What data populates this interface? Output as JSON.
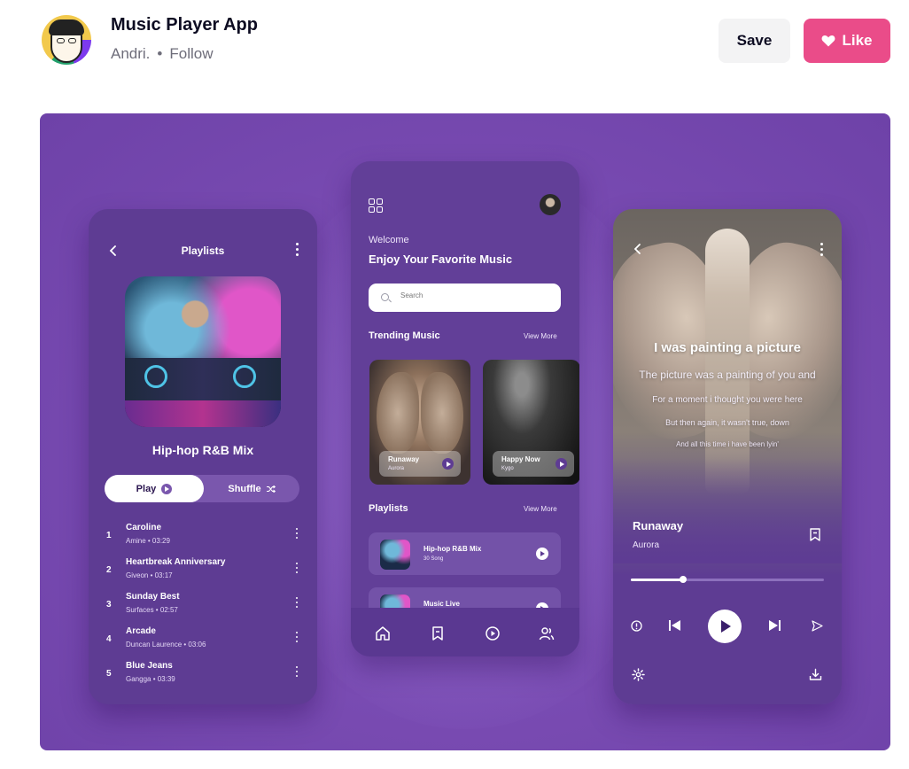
{
  "header": {
    "title": "Music Player App",
    "author": "Andri.",
    "separator": "•",
    "follow_label": "Follow",
    "save_label": "Save",
    "like_label": "Like",
    "like_color": "#ea4c89"
  },
  "shot": {
    "accent": "#7a4cb3",
    "playlist_screen": {
      "title": "Playlists",
      "mix_title": "Hip-hop R&B Mix",
      "play_label": "Play",
      "shuffle_label": "Shuffle",
      "tracks": [
        {
          "num": "1",
          "name": "Caroline",
          "meta": "Amine • 03:29"
        },
        {
          "num": "2",
          "name": "Heartbreak Anniversary",
          "meta": "Giveon • 03:17"
        },
        {
          "num": "3",
          "name": "Sunday Best",
          "meta": "Surfaces • 02:57"
        },
        {
          "num": "4",
          "name": "Arcade",
          "meta": "Duncan Laurence • 03:06"
        },
        {
          "num": "5",
          "name": "Blue Jeans",
          "meta": "Gangga • 03:39"
        }
      ]
    },
    "home_screen": {
      "welcome": "Welcome",
      "headline": "Enjoy Your Favorite Music",
      "search_placeholder": "Search",
      "trending_title": "Trending Music",
      "view_more": "View More",
      "trending": [
        {
          "title": "Runaway",
          "artist": "Aurora"
        },
        {
          "title": "Happy Now",
          "artist": "Kygo"
        }
      ],
      "playlists_title": "Playlists",
      "playlists": [
        {
          "title": "Hip-hop R&B Mix",
          "sub": "30 Song"
        },
        {
          "title": "Music Live",
          "sub": ""
        }
      ],
      "tabs": [
        "home-icon",
        "bookmark-icon",
        "play-circle-icon",
        "profile-icon"
      ]
    },
    "player_screen": {
      "lyrics": [
        "I was painting a picture",
        "The picture was a painting of  you and",
        "For a moment i thought you were here",
        "But then again, it wasn't true, down",
        "And all this time i have been lyin'"
      ],
      "song_title": "Runaway",
      "song_artist": "Aurora",
      "progress": 0.27
    }
  }
}
